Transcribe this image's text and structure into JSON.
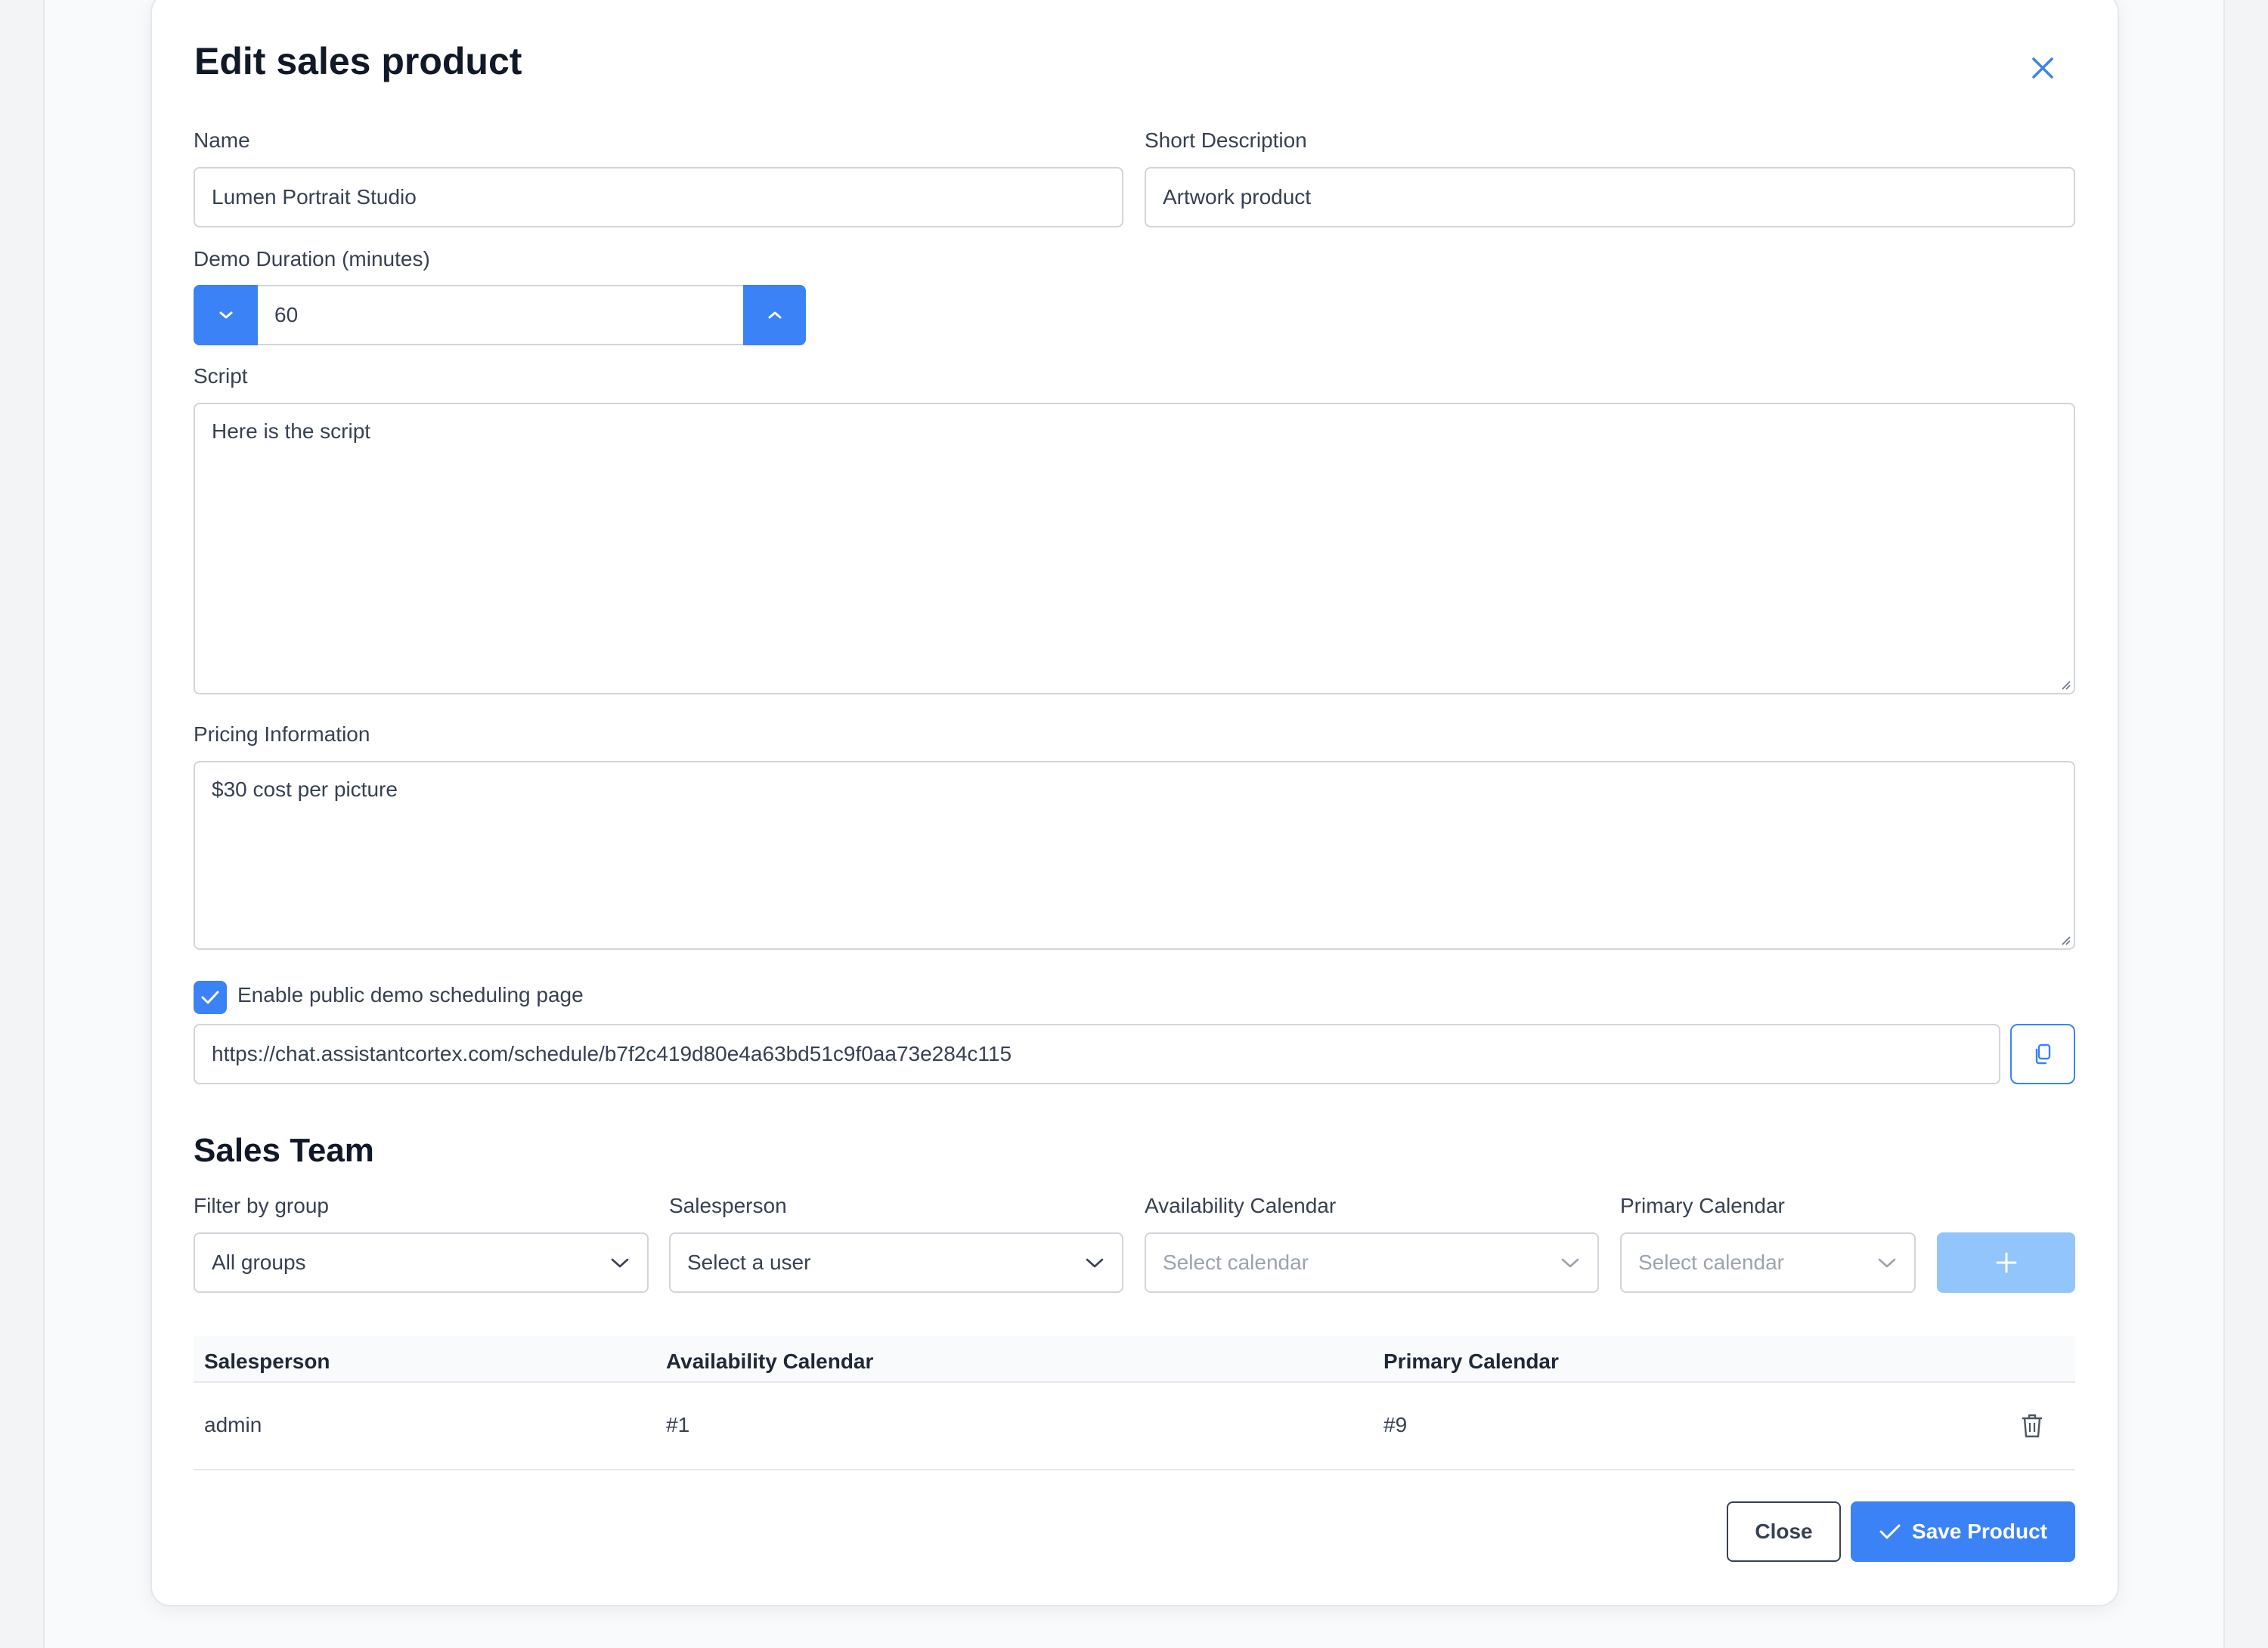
{
  "modal": {
    "title": "Edit sales product"
  },
  "form": {
    "name": {
      "label": "Name",
      "value": "Lumen Portrait Studio"
    },
    "short_description": {
      "label": "Short Description",
      "value": "Artwork product"
    },
    "demo_duration": {
      "label": "Demo Duration (minutes)",
      "value": "60"
    },
    "script": {
      "label": "Script",
      "value": "Here is the script"
    },
    "pricing": {
      "label": "Pricing Information",
      "value": "$30 cost per picture"
    },
    "public_scheduling": {
      "label": "Enable public demo scheduling page",
      "checked": true,
      "url": "https://chat.assistantcortex.com/schedule/b7f2c419d80e4a63bd51c9f0aa73e284c115"
    }
  },
  "sales_team": {
    "title": "Sales Team",
    "filters": {
      "group": {
        "label": "Filter by group",
        "value": "All groups"
      },
      "salesperson": {
        "label": "Salesperson",
        "value": "Select a user"
      },
      "availability": {
        "label": "Availability Calendar",
        "placeholder": "Select calendar"
      },
      "primary": {
        "label": "Primary Calendar",
        "placeholder": "Select calendar"
      }
    },
    "table": {
      "columns": [
        "Salesperson",
        "Availability Calendar",
        "Primary Calendar"
      ],
      "rows": [
        {
          "salesperson": "admin",
          "availability": "#1",
          "primary": "#9"
        }
      ]
    }
  },
  "footer": {
    "close_label": "Close",
    "save_label": "Save Product"
  },
  "colors": {
    "accent": "#3b82f6",
    "accent_disabled": "#93c5fd",
    "border": "#d1d5db",
    "text": "#374151"
  },
  "icons": {
    "close": "close-icon",
    "decrement": "chevron-down-icon",
    "increment": "chevron-up-icon",
    "checkbox": "check-icon",
    "copy": "copy-icon",
    "select": "chevron-down-icon",
    "add": "plus-icon",
    "delete": "trash-icon",
    "save": "check-icon"
  }
}
